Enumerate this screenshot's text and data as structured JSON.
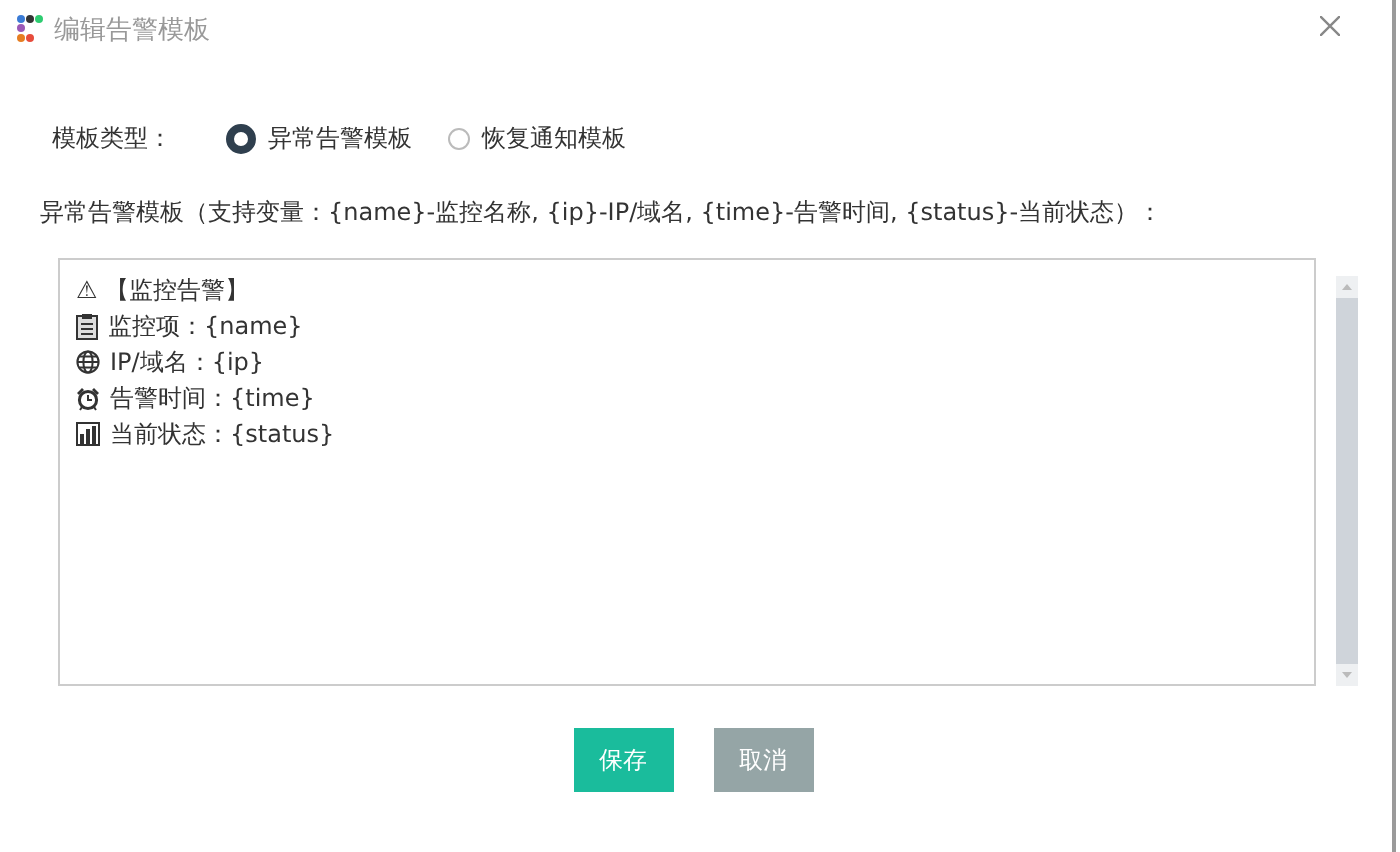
{
  "window": {
    "title": "编辑告警模板"
  },
  "template_type": {
    "label": "模板类型：",
    "options": [
      {
        "label": "异常告警模板",
        "selected": true
      },
      {
        "label": "恢复通知模板",
        "selected": false
      }
    ]
  },
  "editor": {
    "label": "异常告警模板（支持变量：{name}-监控名称, {ip}-IP/域名, {time}-告警时间, {status}-当前状态）：",
    "lines": [
      {
        "text": "⚠ 【监控告警】"
      },
      {
        "text": "监控项：{name}"
      },
      {
        "text": "IP/域名：{ip}"
      },
      {
        "text": "告警时间：{time}"
      },
      {
        "text": "当前状态：{status}"
      }
    ]
  },
  "buttons": [
    {
      "label": "保存",
      "kind": "primary"
    },
    {
      "label": "取消",
      "kind": "secondary"
    }
  ]
}
